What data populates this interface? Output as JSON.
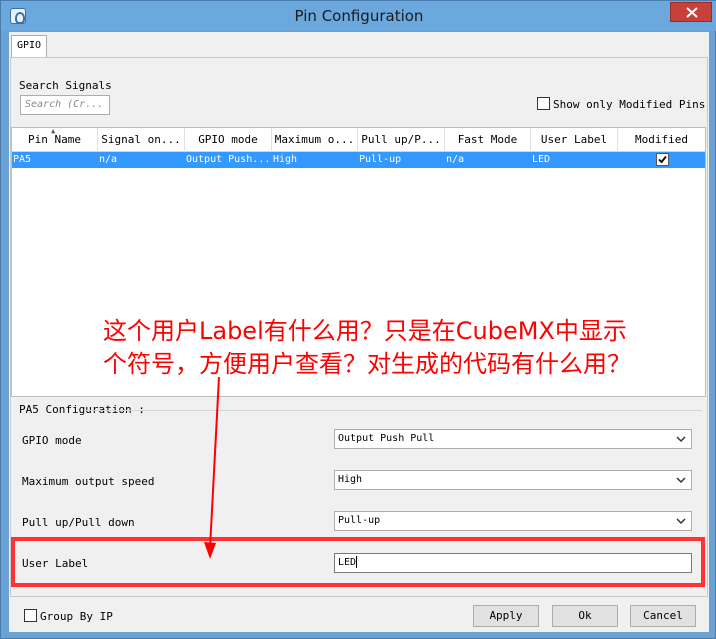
{
  "window": {
    "title": "Pin Configuration"
  },
  "tabs": [
    {
      "label": "GPIO"
    }
  ],
  "search": {
    "label": "Search Signals",
    "placeholder": "Search (Cr..."
  },
  "filter": {
    "show_modified_label": "Show only Modified Pins",
    "checked": false
  },
  "table": {
    "headers": [
      "Pin Name",
      "Signal on...",
      "GPIO mode",
      "Maximum o...",
      "Pull up/P...",
      "Fast Mode",
      "User Label",
      "Modified"
    ],
    "rows": [
      {
        "pin": "PA5",
        "signal": "n/a",
        "gpio_mode": "Output Push...",
        "max_speed": "High",
        "pull": "Pull-up",
        "fast_mode": "n/a",
        "user_label": "LED",
        "modified": true
      }
    ]
  },
  "annotation": {
    "line1": "这个用户Label有什么用？只是在CubeMX中显示",
    "line2": "个符号，方便用户查看？对生成的代码有什么用？",
    "color": "#ff0000"
  },
  "config": {
    "title": "PA5 Configuration :",
    "fields": [
      {
        "label": "GPIO mode",
        "value": "Output Push Pull"
      },
      {
        "label": "Maximum output speed",
        "value": "High"
      },
      {
        "label": "Pull up/Pull down",
        "value": "Pull-up"
      },
      {
        "label": "User Label",
        "value": "LED"
      }
    ]
  },
  "footer": {
    "group_by_ip_label": "Group By IP",
    "apply_label": "Apply",
    "ok_label": "Ok",
    "cancel_label": "Cancel"
  },
  "colors": {
    "selection": "#3399ff",
    "highlight": "#ff3333",
    "titlebar": "#6aa8de",
    "close": "#c7403a"
  }
}
